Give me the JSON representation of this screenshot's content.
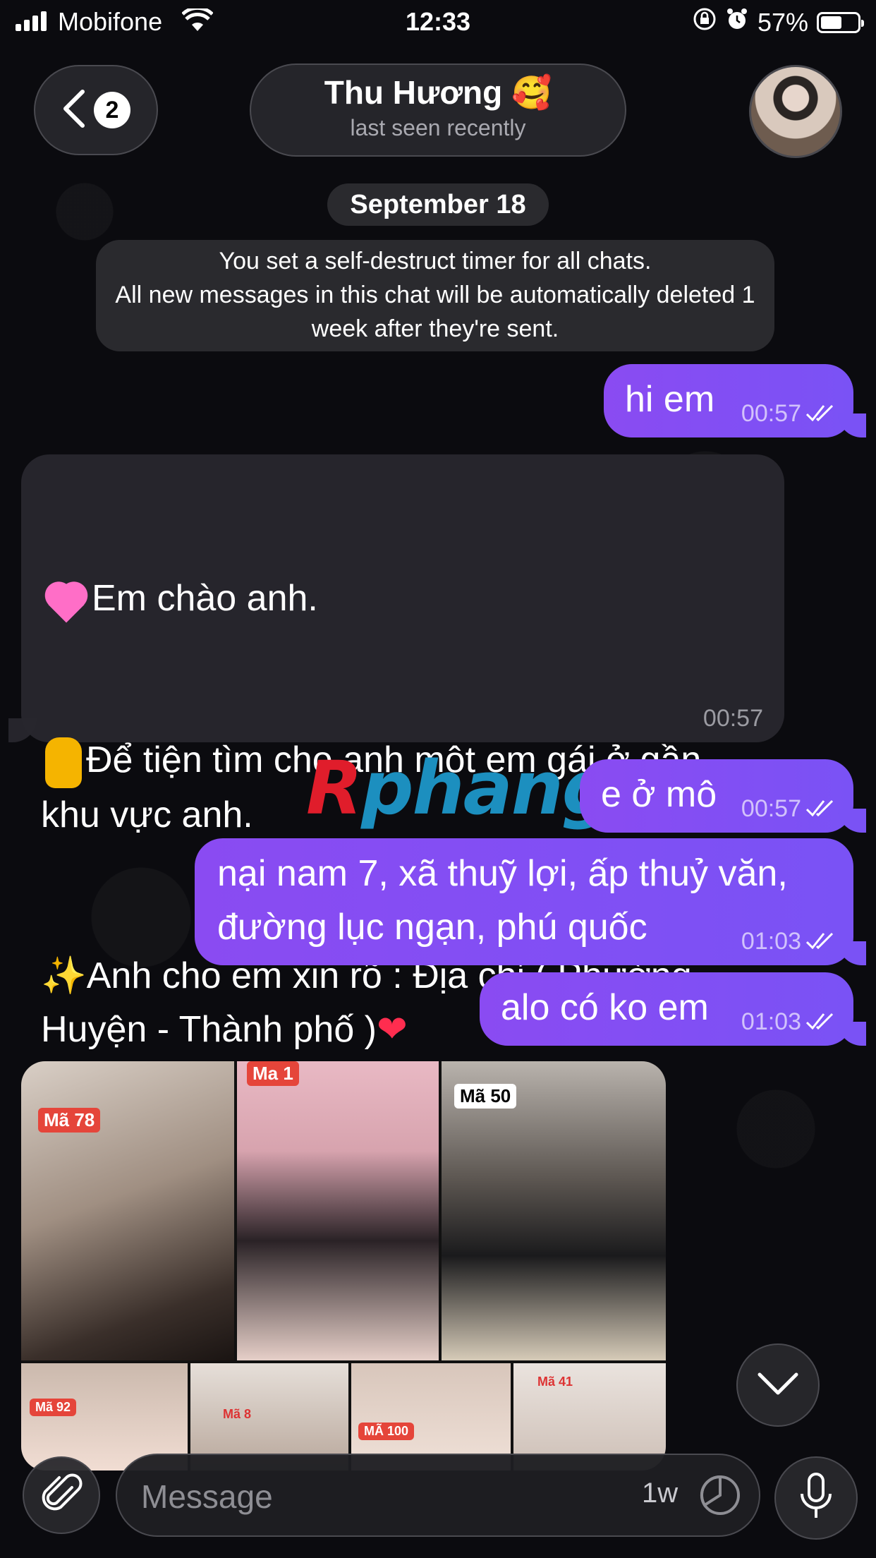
{
  "status_bar": {
    "carrier": "Mobifone",
    "time": "12:33",
    "battery": "57%",
    "battery_level": 0.57
  },
  "header": {
    "unread_count": "2",
    "contact_name": "Thu Hương 🥰",
    "contact_status": "last seen recently"
  },
  "service": {
    "date": "September 18",
    "timer_notice": "You set a self-destruct timer for all chats.\nAll new messages in this chat will be automatically deleted 1 week after they're sent."
  },
  "messages": [
    {
      "direction": "out",
      "text": "hi em",
      "time": "00:57"
    },
    {
      "direction": "in",
      "line1": "Em chào anh.",
      "line2": "Để tiện tìm cho anh một em gái ở gần khu vực anh.",
      "line3": "Anh cho em xin rõ : Địa chỉ ( Phường - Huyện - Thành phố )",
      "time": "00:57"
    },
    {
      "direction": "out",
      "text": "e ở mô",
      "time": "00:57"
    },
    {
      "direction": "out",
      "text": "nại nam 7, xã thuỹ lợi, ấp thuỷ văn, đường lục ngạn, phú quốc",
      "time": "01:03"
    },
    {
      "direction": "out",
      "text": "alo có ko em",
      "time": "01:03"
    }
  ],
  "watermark": {
    "first": "R",
    "rest": "phang"
  },
  "photos": {
    "labels": [
      "Mã 78",
      "Ma 1",
      "Mã 50",
      "Mã 92",
      "Mã 8",
      "MÃ 100",
      "Mã 41"
    ]
  },
  "input": {
    "placeholder": "Message",
    "timer": "1w"
  },
  "icons": [
    "signal-icon",
    "wifi-icon",
    "lock-rotation-icon",
    "alarm-icon",
    "battery-icon",
    "back-chevron-icon",
    "double-check-icon",
    "chevron-down-icon",
    "paperclip-icon",
    "timer-icon",
    "microphone-icon"
  ]
}
